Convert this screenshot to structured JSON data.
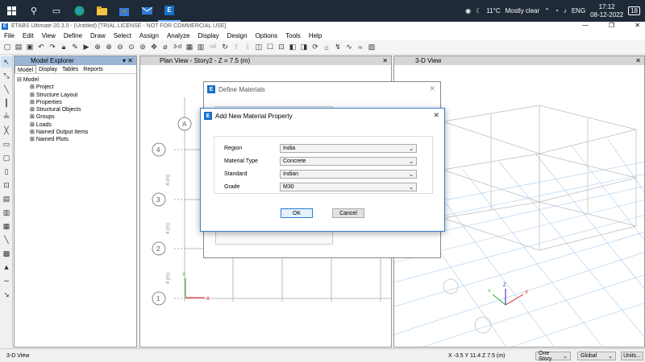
{
  "taskbar": {
    "weather_temp": "11°C",
    "weather_text": "Mostly clear",
    "language": "ENG",
    "time": "17:12",
    "date": "08-12-2022",
    "notification_count": "18"
  },
  "app": {
    "title": "ETABS Ultimate 20.3.0 - (Untitled)  [TRIAL LICENSE - NOT FOR COMMERCIAL USE]"
  },
  "menu": [
    "File",
    "Edit",
    "View",
    "Define",
    "Draw",
    "Select",
    "Assign",
    "Analyze",
    "Display",
    "Design",
    "Options",
    "Tools",
    "Help"
  ],
  "toolbar": {
    "zoom_3d_label": "3-d",
    "nd_label": "nd"
  },
  "explorer": {
    "title": "Model Explorer",
    "tabs": [
      "Model",
      "Display",
      "Tables",
      "Reports"
    ],
    "root": "Model",
    "items": [
      "Project",
      "Structure Layout",
      "Properties",
      "Structural Objects",
      "Groups",
      "Loads",
      "Named Output Items",
      "Named Plots"
    ]
  },
  "plan_view": {
    "title": "Plan View - Story2 - Z = 7.5 (m)",
    "grid_labels": [
      "A",
      "4",
      "3",
      "2",
      "1"
    ],
    "dim_labels": [
      "4 (m)",
      "4 (m)",
      "4 (m)"
    ]
  },
  "view3d": {
    "title": "3-D View"
  },
  "define_materials": {
    "title": "Define Materials"
  },
  "add_material": {
    "title": "Add New Material Property",
    "fields": [
      {
        "label": "Region",
        "value": "India"
      },
      {
        "label": "Material Type",
        "value": "Concrete"
      },
      {
        "label": "Standard",
        "value": "Indian"
      },
      {
        "label": "Grade",
        "value": "M30"
      }
    ],
    "ok_label": "OK",
    "cancel_label": "Cancel"
  },
  "status": {
    "left": "3-D View",
    "coords": "X -3.5  Y 11.4  Z 7.5 (m)",
    "story": "One Story",
    "coord_sys": "Global",
    "units_button": "Units..."
  },
  "colors": {
    "accent": "#1670c6",
    "explorer_header": "#9ab5d6",
    "grid_blue": "#6fa8dc"
  }
}
